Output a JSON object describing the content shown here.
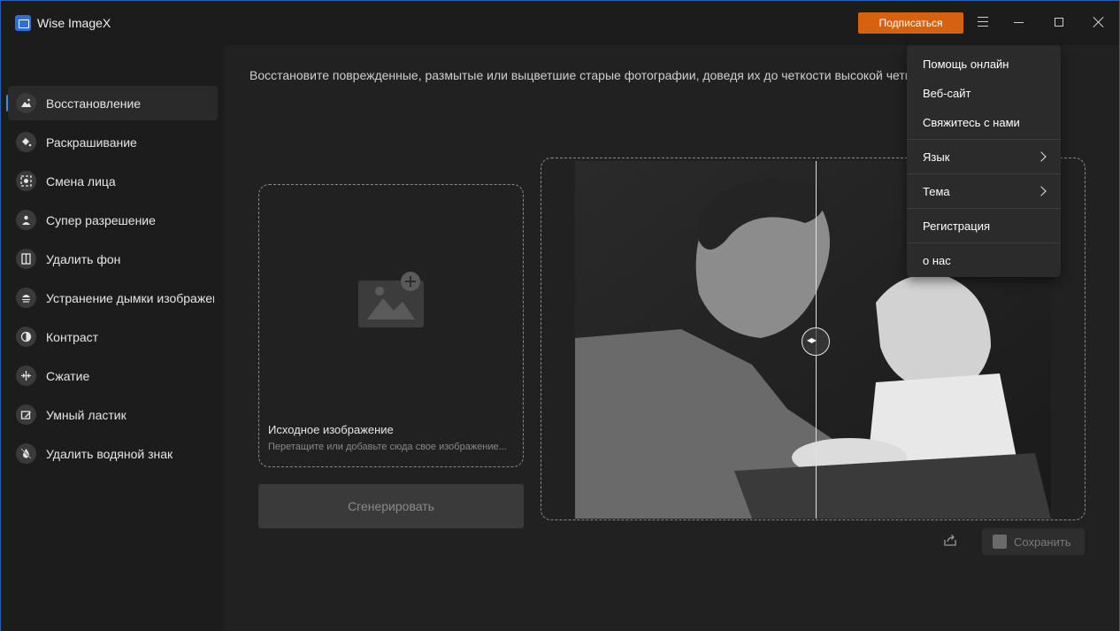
{
  "app": {
    "title": "Wise ImageX",
    "subscribe_label": "Подписаться"
  },
  "sidebar": {
    "items": [
      {
        "label": "Восстановление",
        "icon": "restore-icon",
        "active": true
      },
      {
        "label": "Раскрашивание",
        "icon": "paint-bucket-icon"
      },
      {
        "label": "Смена лица",
        "icon": "face-swap-icon"
      },
      {
        "label": "Супер разрешение",
        "icon": "super-resolution-icon"
      },
      {
        "label": "Удалить фон",
        "icon": "remove-background-icon"
      },
      {
        "label": "Устранение дымки изображения",
        "icon": "dehaze-icon"
      },
      {
        "label": "Контраст",
        "icon": "contrast-icon"
      },
      {
        "label": "Сжатие",
        "icon": "compress-icon"
      },
      {
        "label": "Умный ластик",
        "icon": "eraser-icon"
      },
      {
        "label": "Удалить водяной знак",
        "icon": "remove-watermark-icon"
      }
    ]
  },
  "main": {
    "description": "Восстановите поврежденные, размытые или выцветшие старые фотографии, доведя их до четкости высокой четкости исходного и",
    "upload": {
      "title": "Исходное изображение",
      "hint": "Перетащите или добавьте сюда свое изображение..."
    },
    "generate_label": "Сгенерировать",
    "save_label": "Сохранить"
  },
  "dropdown": {
    "items": [
      {
        "label": "Помощь онлайн"
      },
      {
        "label": "Веб-сайт"
      },
      {
        "label": "Свяжитесь с нами"
      },
      {
        "label": "Язык",
        "submenu": true
      },
      {
        "label": "Тема",
        "submenu": true
      },
      {
        "label": "Регистрация"
      },
      {
        "label": "о нас"
      }
    ]
  },
  "colors": {
    "accent": "#d6610f",
    "active_indicator": "#3a8ee6",
    "background": "#1c1c1c"
  }
}
